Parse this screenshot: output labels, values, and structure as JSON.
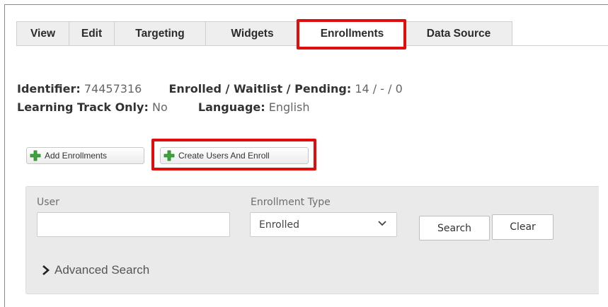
{
  "tabs": [
    {
      "label": "View"
    },
    {
      "label": "Edit"
    },
    {
      "label": "Targeting"
    },
    {
      "label": "Widgets"
    },
    {
      "label": "Enrollments",
      "active": true
    },
    {
      "label": "Data Source"
    }
  ],
  "info": {
    "identifier_label": "Identifier:",
    "identifier_value": "74457316",
    "enrolled_label": "Enrolled / Waitlist / Pending:",
    "enrolled_value": "14 / - / 0",
    "learning_track_label": "Learning Track Only:",
    "learning_track_value": "No",
    "language_label": "Language:",
    "language_value": "English"
  },
  "actions": {
    "add_enrollments": "Add Enrollments",
    "create_users_and_enroll": "Create Users And Enroll"
  },
  "search": {
    "user_label": "User",
    "user_value": "",
    "enrollment_type_label": "Enrollment Type",
    "enrollment_type_value": "Enrolled",
    "search_button": "Search",
    "clear_button": "Clear",
    "advanced_search": "Advanced Search"
  },
  "colors": {
    "highlight": "#e10d0d",
    "plus_icon": "#3aa63a"
  }
}
